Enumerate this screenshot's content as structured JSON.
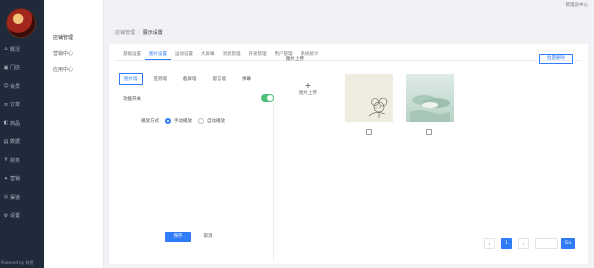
{
  "user": "管理员中心",
  "sidebar": {
    "items": [
      {
        "icon": "home-icon",
        "glyph": "⌂",
        "label": "概况"
      },
      {
        "icon": "store-icon",
        "glyph": "▣",
        "label": "门店"
      },
      {
        "icon": "member-icon",
        "glyph": "☺",
        "label": "会员"
      },
      {
        "icon": "order-icon",
        "glyph": "≡",
        "label": "订单"
      },
      {
        "icon": "goods-icon",
        "glyph": "◧",
        "label": "商品"
      },
      {
        "icon": "data-icon",
        "glyph": "▤",
        "label": "数据"
      },
      {
        "icon": "finance-icon",
        "glyph": "¥",
        "label": "财务"
      },
      {
        "icon": "marketing-icon",
        "glyph": "✦",
        "label": "营销"
      },
      {
        "icon": "channel-icon",
        "glyph": "◎",
        "label": "渠道"
      },
      {
        "icon": "settings-icon",
        "glyph": "⚙",
        "label": "设置"
      }
    ],
    "footer": "Powered by 有赞"
  },
  "subnav": {
    "items": [
      "店铺管理",
      "营销中心",
      "应用中心"
    ]
  },
  "breadcrumb": {
    "parent": "店铺管理",
    "current": "展示设置"
  },
  "tabs": [
    "基础设置",
    "图片设置",
    "运动设置",
    "大屏幕",
    "消息管理",
    "开发管理",
    "用户管理",
    "系统统计"
  ],
  "chips": [
    "图片墙",
    "签到墙",
    "截屏墙",
    "留言墙",
    "弹幕"
  ],
  "left": {
    "heading": "功能开关",
    "mode_label": "播放方式",
    "radio_auto": "手动播放",
    "radio_loop": "自动播放",
    "save": "保存",
    "cancel": "取消"
  },
  "right": {
    "heading": "图片上传",
    "batch": "批量删除",
    "upload": "图片上传"
  },
  "pager": {
    "prev": "‹",
    "page": "1",
    "next": "›",
    "go": "Go"
  },
  "colors": {
    "accent": "#2f7cf6",
    "toggle": "#4fc07a",
    "sidebar": "#1f2a3a"
  }
}
